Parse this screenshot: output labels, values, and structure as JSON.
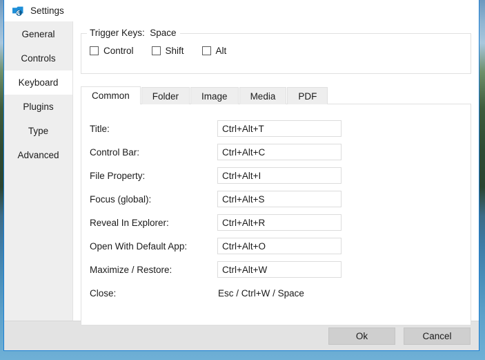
{
  "window": {
    "title": "Settings",
    "icon": "camera-icon",
    "border_color": "#1a7fd4"
  },
  "sidebar": {
    "items": [
      {
        "label": "General",
        "active": false
      },
      {
        "label": "Controls",
        "active": false
      },
      {
        "label": "Keyboard",
        "active": true
      },
      {
        "label": "Plugins",
        "active": false
      },
      {
        "label": "Type",
        "active": false
      },
      {
        "label": "Advanced",
        "active": false
      }
    ]
  },
  "trigger_group": {
    "legend": "Trigger Keys:  Space",
    "checkboxes": [
      {
        "label": "Control",
        "checked": false
      },
      {
        "label": "Shift",
        "checked": false
      },
      {
        "label": "Alt",
        "checked": false
      }
    ]
  },
  "tabs": [
    {
      "label": "Common",
      "active": true
    },
    {
      "label": "Folder",
      "active": false
    },
    {
      "label": "Image",
      "active": false
    },
    {
      "label": "Media",
      "active": false
    },
    {
      "label": "PDF",
      "active": false
    }
  ],
  "shortcuts": [
    {
      "label": "Title:",
      "value": "Ctrl+Alt+T",
      "editable": true
    },
    {
      "label": "Control Bar:",
      "value": "Ctrl+Alt+C",
      "editable": true
    },
    {
      "label": "File Property:",
      "value": "Ctrl+Alt+I",
      "editable": true
    },
    {
      "label": "Focus (global):",
      "value": "Ctrl+Alt+S",
      "editable": true
    },
    {
      "label": "Reveal In Explorer:",
      "value": "Ctrl+Alt+R",
      "editable": true
    },
    {
      "label": "Open With Default App:",
      "value": "Ctrl+Alt+O",
      "editable": true
    },
    {
      "label": "Maximize / Restore:",
      "value": "Ctrl+Alt+W",
      "editable": true
    },
    {
      "label": "Close:",
      "value": "Esc / Ctrl+W / Space",
      "editable": false
    }
  ],
  "footer": {
    "ok_label": "Ok",
    "cancel_label": "Cancel"
  }
}
